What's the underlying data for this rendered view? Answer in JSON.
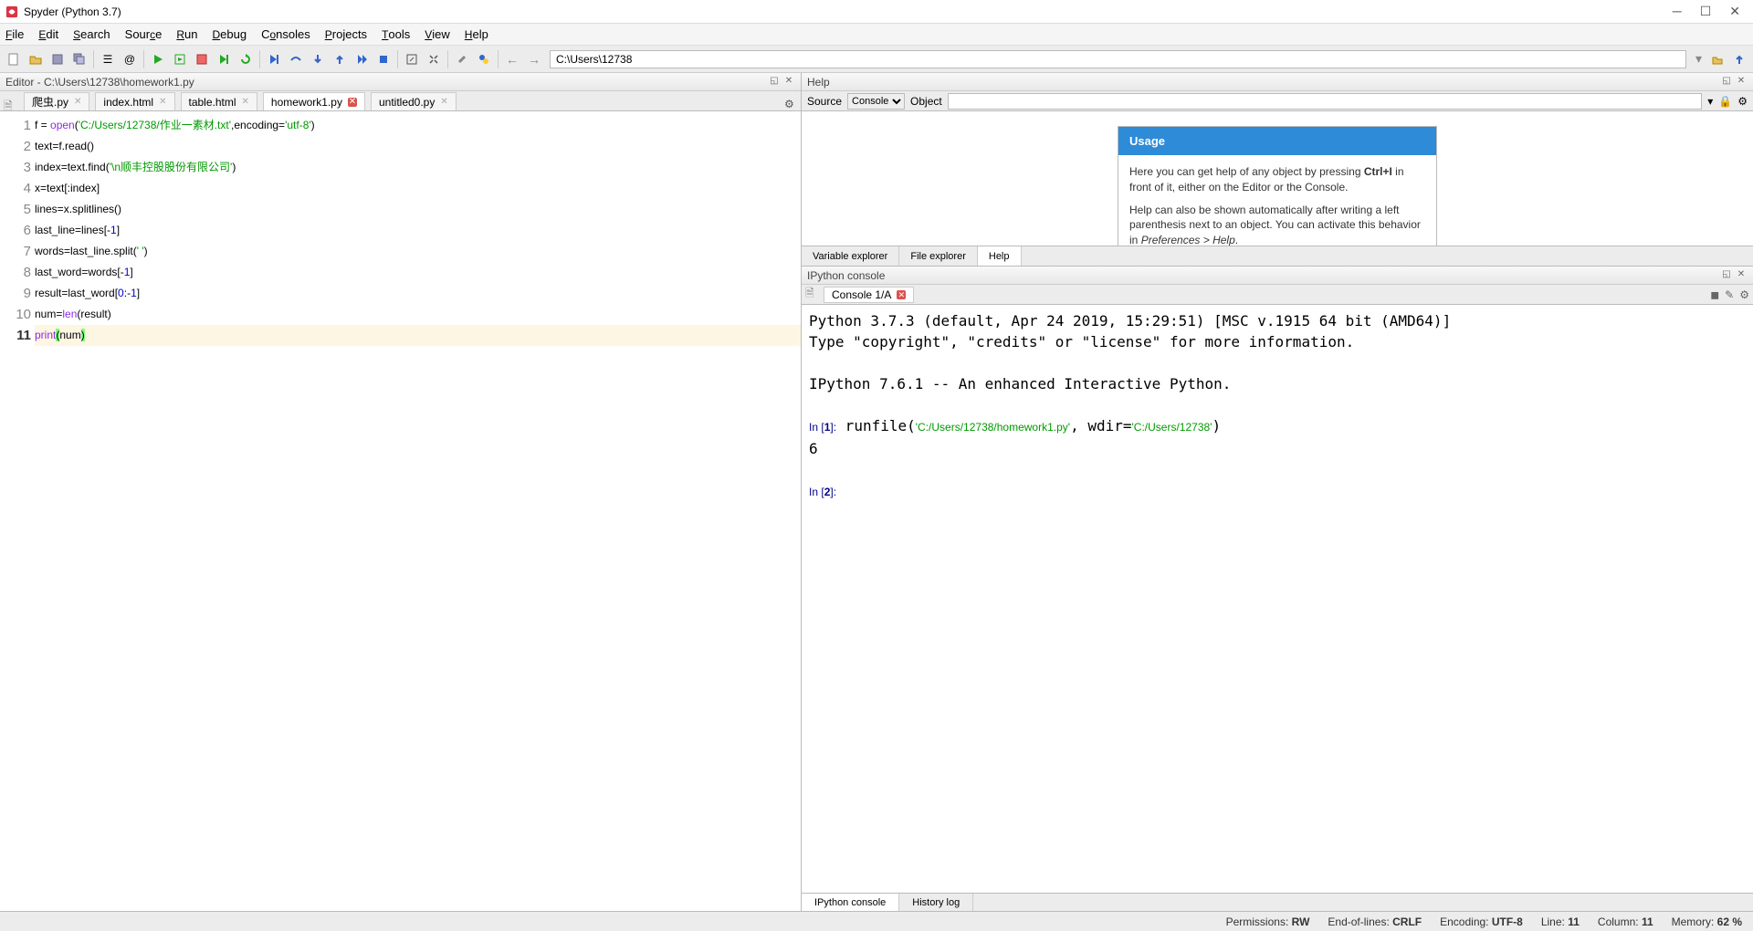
{
  "window": {
    "title": "Spyder (Python 3.7)"
  },
  "menubar": [
    "File",
    "Edit",
    "Search",
    "Source",
    "Run",
    "Debug",
    "Consoles",
    "Projects",
    "Tools",
    "View",
    "Help"
  ],
  "toolbar": {
    "path": "C:\\Users\\12738"
  },
  "editor": {
    "header": "Editor - C:\\Users\\12738\\homework1.py",
    "tabs": [
      {
        "label": "爬虫.py",
        "modified": false,
        "active": false
      },
      {
        "label": "index.html",
        "modified": false,
        "active": false
      },
      {
        "label": "table.html",
        "modified": false,
        "active": false
      },
      {
        "label": "homework1.py",
        "modified": true,
        "active": true
      },
      {
        "label": "untitled0.py",
        "modified": false,
        "active": false
      }
    ],
    "code_lines": [
      {
        "n": 1,
        "tokens": [
          [
            "",
            "f = "
          ],
          [
            "builtin",
            "open"
          ],
          [
            "",
            "("
          ],
          [
            "str",
            "'C:/Users/12738/作业一素材.txt'"
          ],
          [
            "",
            ",encoding="
          ],
          [
            "str",
            "'utf-8'"
          ],
          [
            "",
            ")"
          ]
        ]
      },
      {
        "n": 2,
        "tokens": [
          [
            "",
            "text=f.read()"
          ]
        ]
      },
      {
        "n": 3,
        "tokens": [
          [
            "",
            "index=text.find("
          ],
          [
            "str",
            "'\\n顺丰控股股份有限公司'"
          ],
          [
            "",
            ")"
          ]
        ]
      },
      {
        "n": 4,
        "tokens": [
          [
            "",
            "x=text[:index]"
          ]
        ]
      },
      {
        "n": 5,
        "tokens": [
          [
            "",
            "lines=x.splitlines()"
          ]
        ]
      },
      {
        "n": 6,
        "tokens": [
          [
            "",
            "last_line=lines[-"
          ],
          [
            "def",
            "1"
          ],
          [
            "",
            "]"
          ]
        ]
      },
      {
        "n": 7,
        "tokens": [
          [
            "",
            "words=last_line.split("
          ],
          [
            "str",
            "' '"
          ],
          [
            "",
            ")"
          ]
        ]
      },
      {
        "n": 8,
        "tokens": [
          [
            "",
            "last_word=words[-"
          ],
          [
            "def",
            "1"
          ],
          [
            "",
            "]"
          ]
        ]
      },
      {
        "n": 9,
        "tokens": [
          [
            "",
            "result=last_word["
          ],
          [
            "def",
            "0"
          ],
          [
            "",
            ":-"
          ],
          [
            "def",
            "1"
          ],
          [
            "",
            "]"
          ]
        ]
      },
      {
        "n": 10,
        "tokens": [
          [
            "",
            "num="
          ],
          [
            "builtin",
            "len"
          ],
          [
            "",
            "(result)"
          ]
        ]
      },
      {
        "n": 11,
        "current": true,
        "tokens": [
          [
            "builtin",
            "print"
          ],
          [
            "paren",
            "("
          ],
          [
            "",
            "num"
          ],
          [
            "paren",
            ")"
          ]
        ]
      }
    ]
  },
  "help": {
    "header": "Help",
    "source_label": "Source",
    "source_value": "Console",
    "object_label": "Object",
    "object_value": "",
    "usage_title": "Usage",
    "usage_p1_a": "Here you can get help of any object by pressing ",
    "usage_p1_key": "Ctrl+I",
    "usage_p1_b": " in front of it, either on the Editor or the Console.",
    "usage_p2_a": "Help can also be shown automatically after writing a left parenthesis next to an object. You can activate this behavior in ",
    "usage_p2_em": "Preferences > Help",
    "usage_p2_b": ".",
    "bottom_tabs": [
      "Variable explorer",
      "File explorer",
      "Help"
    ]
  },
  "ipython": {
    "header": "IPython console",
    "tab_label": "Console 1/A",
    "banner1": "Python 3.7.3 (default, Apr 24 2019, 15:29:51) [MSC v.1915 64 bit (AMD64)]",
    "banner2": "Type \"copyright\", \"credits\" or \"license\" for more information.",
    "banner3": "IPython 7.6.1 -- An enhanced Interactive Python.",
    "in1_prefix": "In [",
    "in1_num": "1",
    "in1_suffix": "]:",
    "in1_cmd": " runfile(",
    "in1_str1": "'C:/Users/12738/homework1.py'",
    "in1_mid": ", wdir=",
    "in1_str2": "'C:/Users/12738'",
    "in1_end": ")",
    "output": "6",
    "in2_num": "2",
    "bottom_tabs": [
      "IPython console",
      "History log"
    ]
  },
  "statusbar": {
    "perm_label": "Permissions:",
    "perm_val": "RW",
    "eol_label": "End-of-lines:",
    "eol_val": "CRLF",
    "enc_label": "Encoding:",
    "enc_val": "UTF-8",
    "line_label": "Line:",
    "line_val": "11",
    "col_label": "Column:",
    "col_val": "11",
    "mem_label": "Memory:",
    "mem_val": "62 %"
  }
}
